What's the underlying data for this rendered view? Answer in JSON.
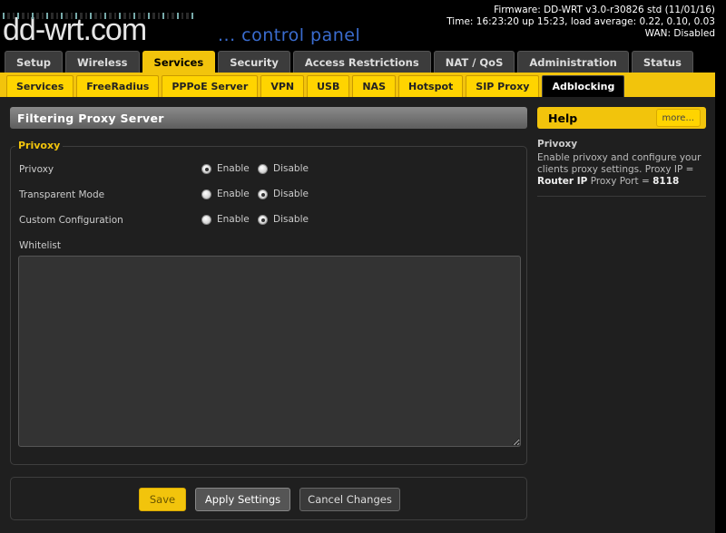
{
  "header": {
    "logo_text": "dd-wrt.com",
    "subtitle": "... control panel",
    "firmware": "Firmware: DD-WRT v3.0-r30826 std (11/01/16)",
    "time": "Time: 16:23:20 up 15:23, load average: 0.22, 0.10, 0.03",
    "wan": "WAN: Disabled"
  },
  "main_tabs": [
    "Setup",
    "Wireless",
    "Services",
    "Security",
    "Access Restrictions",
    "NAT / QoS",
    "Administration",
    "Status"
  ],
  "main_tab_active": "Services",
  "sub_tabs": [
    "Services",
    "FreeRadius",
    "PPPoE Server",
    "VPN",
    "USB",
    "NAS",
    "Hotspot",
    "SIP Proxy",
    "Adblocking"
  ],
  "sub_tab_active": "Adblocking",
  "section": {
    "title": "Filtering Proxy Server",
    "legend": "Privoxy",
    "rows": [
      {
        "label": "Privoxy",
        "enable": "Enable",
        "disable": "Disable",
        "value": "enable"
      },
      {
        "label": "Transparent Mode",
        "enable": "Enable",
        "disable": "Disable",
        "value": "disable"
      },
      {
        "label": "Custom Configuration",
        "enable": "Enable",
        "disable": "Disable",
        "value": "disable"
      }
    ],
    "whitelist_label": "Whitelist",
    "whitelist_value": ""
  },
  "buttons": {
    "save": "Save",
    "apply": "Apply Settings",
    "cancel": "Cancel Changes"
  },
  "help": {
    "title": "Help",
    "more": "more...",
    "heading": "Privoxy",
    "text_1": "Enable privoxy and configure your clients proxy settings. Proxy IP =",
    "bold_1": "Router IP",
    "text_2": "Proxy Port =",
    "bold_2": "8118"
  },
  "colors": {
    "accent": "#f2c40c",
    "background": "#1f1f1f",
    "subtitle_blue": "#3a6ccf"
  }
}
